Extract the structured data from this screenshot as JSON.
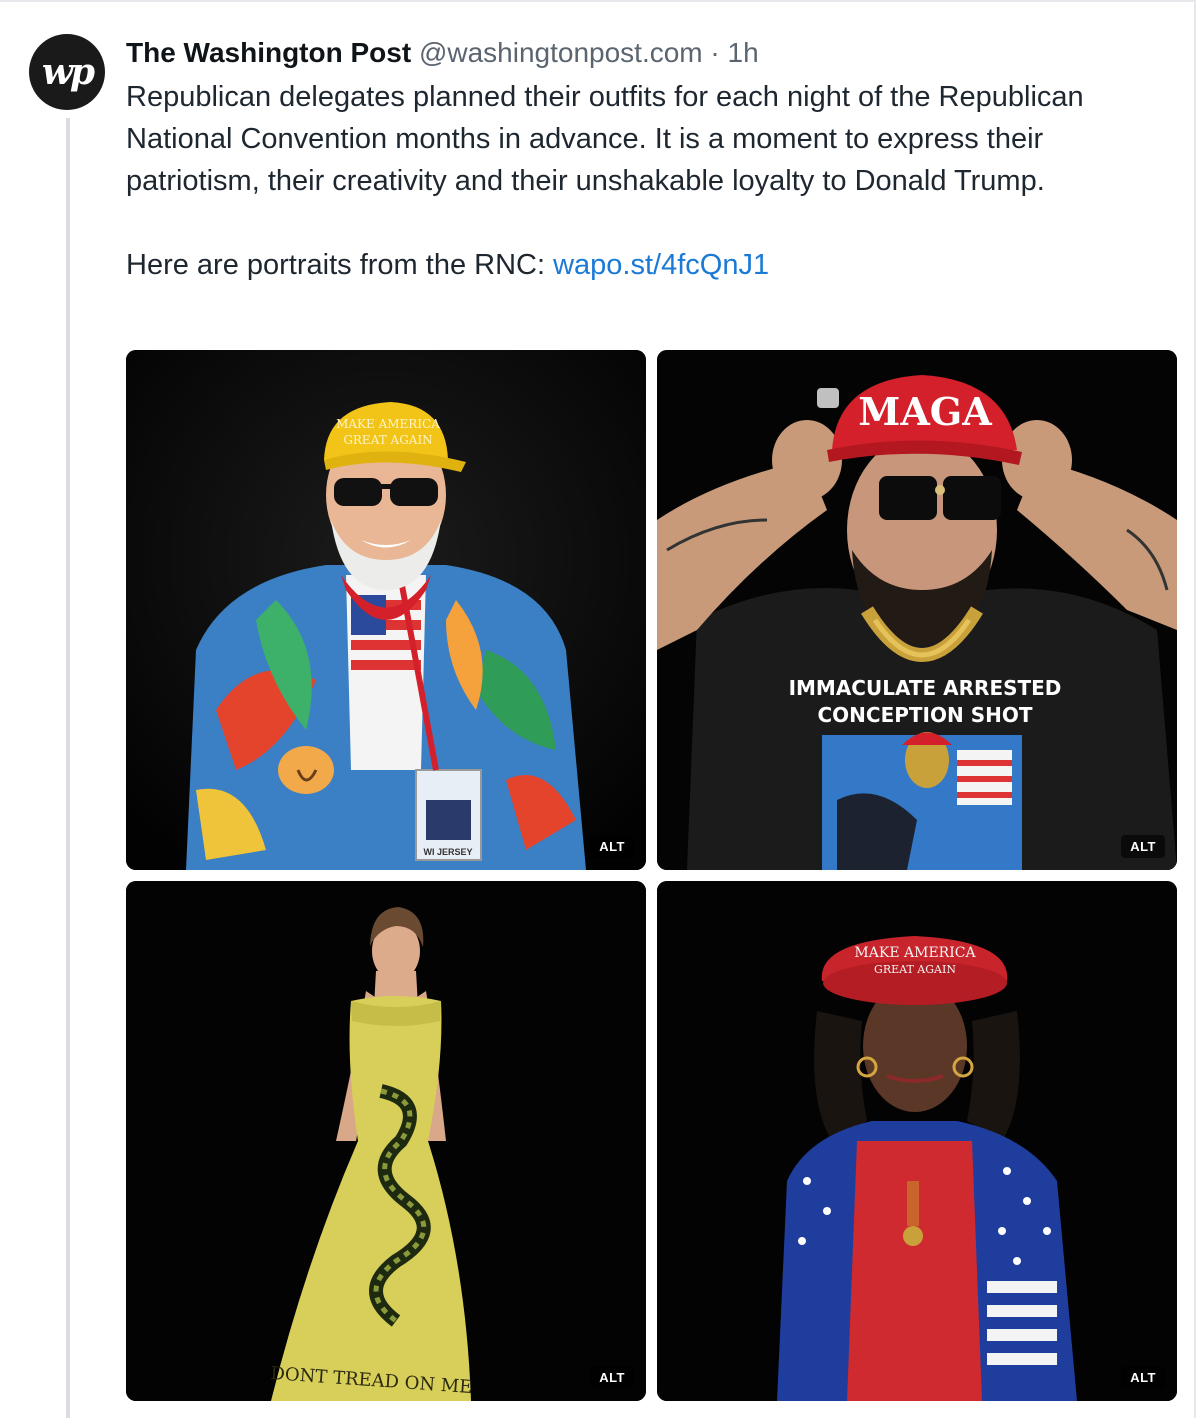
{
  "post": {
    "author_name": "The Washington Post",
    "author_handle": "@washingtonpost.com",
    "separator": "·",
    "timestamp": "1h",
    "avatar_text": "wp",
    "paragraph1": "Republican delegates planned their outfits for each night of the Republican National Convention months in advance. It is a moment to express their patriotism, their creativity and their unshakable loyalty to Donald Trump.",
    "paragraph2_prefix": "Here are portraits from the RNC: ",
    "link_text": "wapo.st/4fcQnJ1"
  },
  "images": [
    {
      "alt_badge": "ALT",
      "hat_text": "MAKE AMERICA GREAT AGAIN",
      "lanyard_text": "WI JERSEY"
    },
    {
      "alt_badge": "ALT",
      "hat_text": "MAGA",
      "shirt_text_1": "IMMACULATE ARRESTED",
      "shirt_text_2": "CONCEPTION SHOT"
    },
    {
      "alt_badge": "ALT",
      "dress_text": "DONT TREAD ON ME"
    },
    {
      "alt_badge": "ALT",
      "hat_text": "MAKE AMERICA GREAT AGAIN"
    }
  ],
  "colors": {
    "link": "#1a7ad6",
    "meta": "#5b6570",
    "maga_red": "#d4202b",
    "maga_yellow": "#f2c418",
    "gadsden_yellow": "#d8cf5a"
  }
}
